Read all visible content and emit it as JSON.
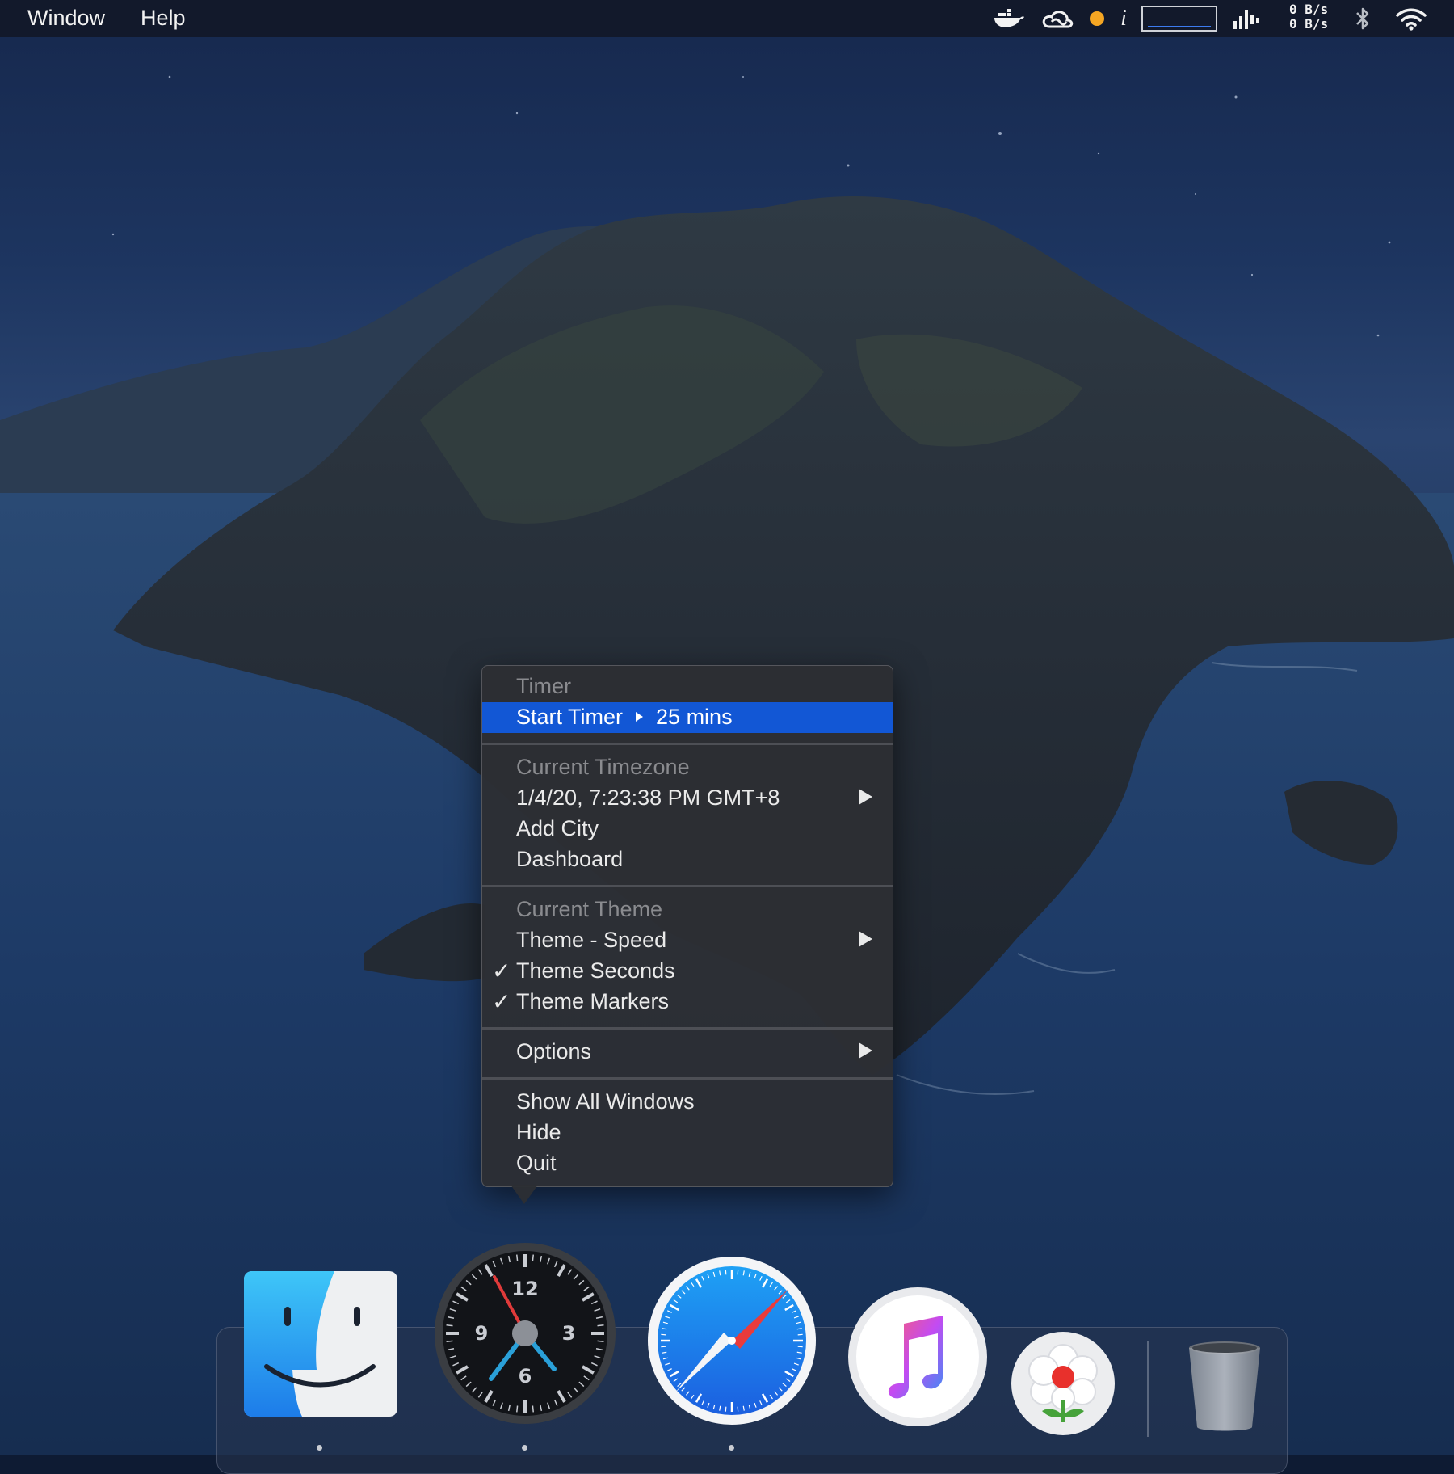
{
  "menubar": {
    "items": [
      "Window",
      "Help"
    ],
    "status_icons": [
      "docker-icon",
      "creative-cloud-icon",
      "orange-dot-icon",
      "info-icon",
      "cpu-graph-icon",
      "signal-bars-icon",
      "bluetooth-icon",
      "wifi-icon"
    ],
    "net_up": "0 B/s",
    "net_down": "0 B/s"
  },
  "menu": {
    "timer_header": "Timer",
    "start_timer": "Start Timer",
    "timer_duration": "25 mins",
    "timezone_header": "Current Timezone",
    "current_time": "1/4/20, 7:23:38 PM GMT+8",
    "add_city": "Add City",
    "dashboard": "Dashboard",
    "theme_header": "Current Theme",
    "theme_speed": "Theme - Speed",
    "theme_seconds": "Theme Seconds",
    "theme_markers": "Theme Markers",
    "options": "Options",
    "show_all_windows": "Show All Windows",
    "hide": "Hide",
    "quit": "Quit",
    "check_glyph": "✓"
  },
  "dock": {
    "apps": [
      "finder-icon",
      "clock-app-icon",
      "safari-icon",
      "music-icon",
      "flower-app-icon",
      "trash-icon"
    ],
    "clock_numerals": [
      "12",
      "3",
      "6",
      "9"
    ],
    "running_indicators": [
      "finder",
      "clock-app",
      "safari"
    ]
  },
  "colors": {
    "highlight": "#1257d5",
    "menu_bg": "#2c2e34",
    "header_text": "#8a8b8f"
  }
}
